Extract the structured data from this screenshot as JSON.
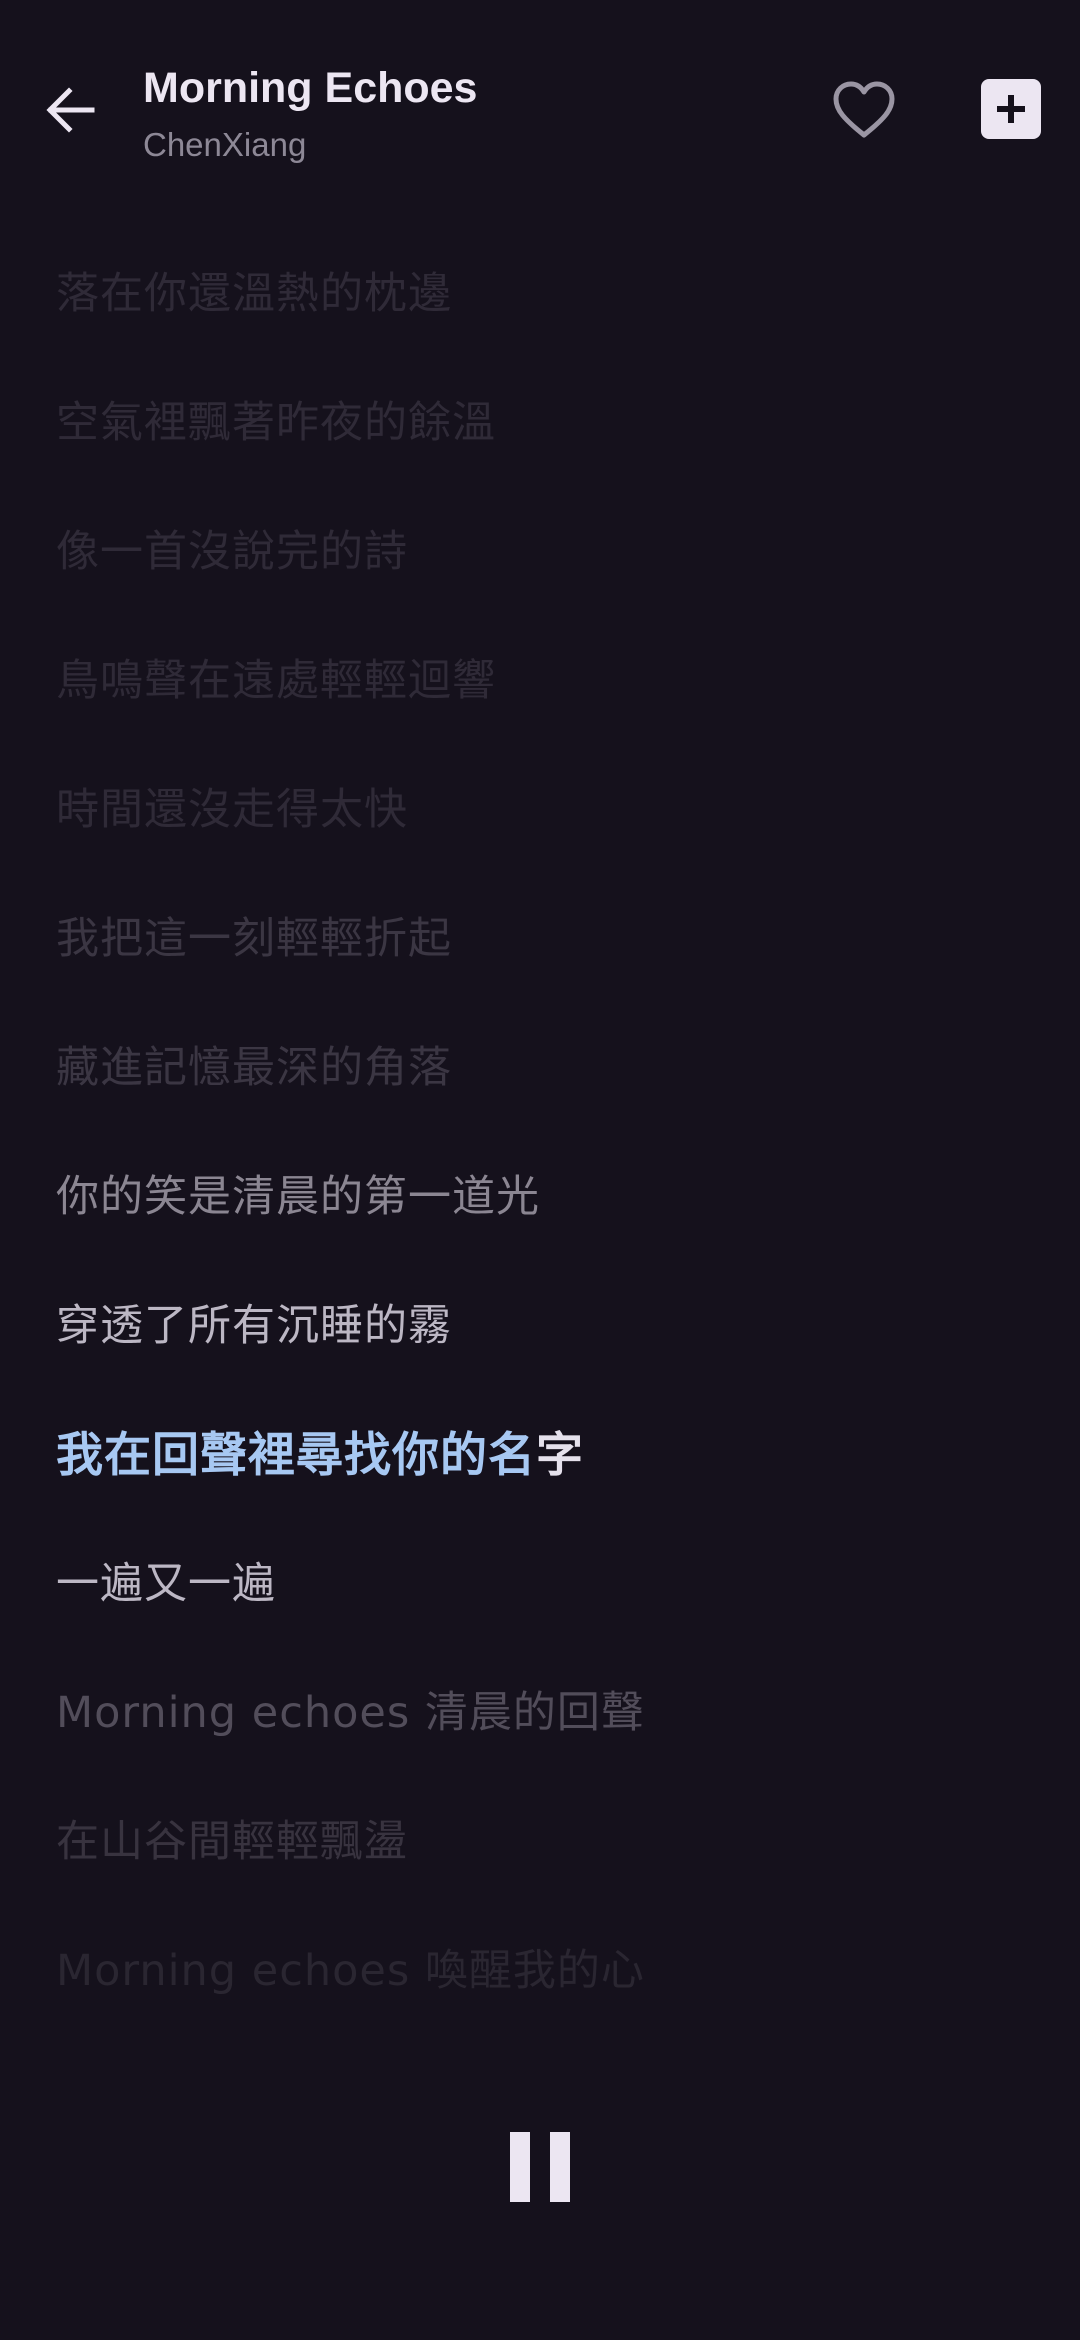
{
  "header": {
    "back_icon": "arrow-left-icon",
    "title": "Morning Echoes",
    "artist": "ChenXiang",
    "favorite_icon": "heart-outline-icon",
    "add_icon": "plus-square-icon"
  },
  "lyrics": {
    "lines": [
      "落在你還溫熱的枕邊",
      "空氣裡飄著昨夜的餘溫",
      "像一首沒說完的詩",
      "鳥鳴聲在遠處輕輕迴響",
      "時間還沒走得太快",
      "我把這一刻輕輕折起",
      "藏進記憶最深的角落",
      "你的笑是清晨的第一道光",
      "穿透了所有沉睡的霧",
      "我在回聲裡尋找你的名字",
      "一遍又一遍",
      "Morning echoes 清晨的回聲",
      "在山谷間輕輕飄盪",
      "Morning echoes 喚醒我的心"
    ],
    "active_line": {
      "sung": "我在回聲裡尋找你的名",
      "unsung": "字"
    }
  },
  "controls": {
    "pause_icon": "pause-icon"
  },
  "colors": {
    "background": "#15111c",
    "accent": "#a7c8f2",
    "text": "#ece6f2"
  }
}
